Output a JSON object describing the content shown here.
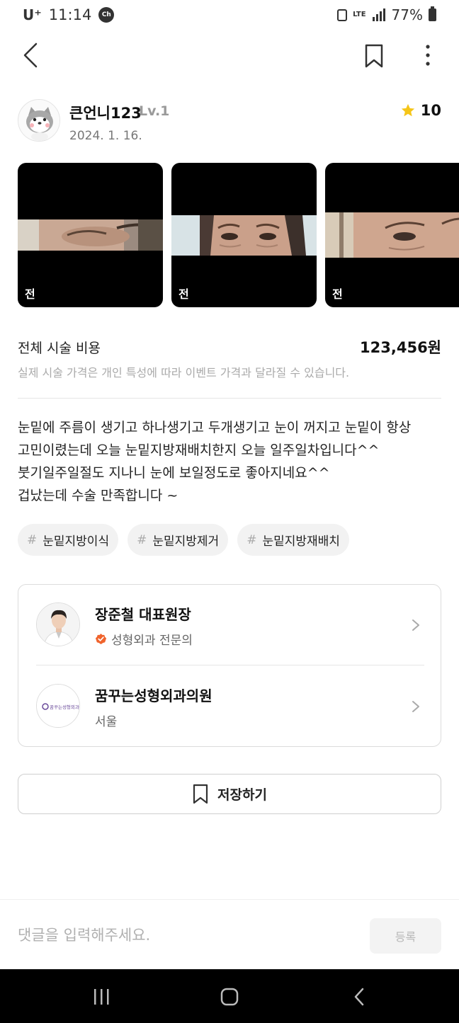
{
  "status_bar": {
    "carrier": "U⁺",
    "time": "11:14",
    "chat_icon_label": "Ch",
    "network": "LTE",
    "battery": "77%"
  },
  "nav": {
    "back_icon": "back-arrow-icon",
    "bookmark_icon": "bookmark-icon",
    "more_icon": "more-vertical-icon"
  },
  "profile": {
    "username": "큰언니123",
    "level": "Lv.1",
    "date": "2024. 1. 16.",
    "rating": "10"
  },
  "photos": [
    {
      "label": "전"
    },
    {
      "label": "전"
    },
    {
      "label": "전"
    }
  ],
  "cost": {
    "title": "전체 시술 비용",
    "value": "123,456원",
    "note": "실제 시술 가격은 개인 특성에 따라 이벤트 가격과 달라질 수 있습니다."
  },
  "review": {
    "lines": [
      "눈밑에 주름이 생기고 하나생기고 두개생기고 눈이 꺼지고 눈밑이 항상",
      "고민이렸는데 오늘  눈밑지방재배치한지 오늘 일주일차입니다^^",
      "붓기일주일절도 지나니 눈에 보일정도로 좋아지네요^^",
      "겁났는데 수술 만족합니다 ~"
    ]
  },
  "tags": [
    {
      "hash": "#",
      "label": "눈밑지방이식"
    },
    {
      "hash": "#",
      "label": "눈밑지방제거"
    },
    {
      "hash": "#",
      "label": "눈밑지방재배치"
    }
  ],
  "doctor": {
    "name": "장준철 대표원장",
    "specialty": "성형외과 전문의"
  },
  "clinic": {
    "name": "꿈꾸는성형외과의원",
    "location": "서울",
    "logo_text": "꿈꾸는성형외과"
  },
  "save_button": {
    "label": "저장하기"
  },
  "comment": {
    "placeholder": "댓글을 입력해주세요.",
    "submit_label": "등록"
  },
  "colors": {
    "accent_star": "#f5c518",
    "badge_orange": "#f0642d",
    "text_primary": "#111111",
    "text_muted": "#aaaaaa"
  }
}
